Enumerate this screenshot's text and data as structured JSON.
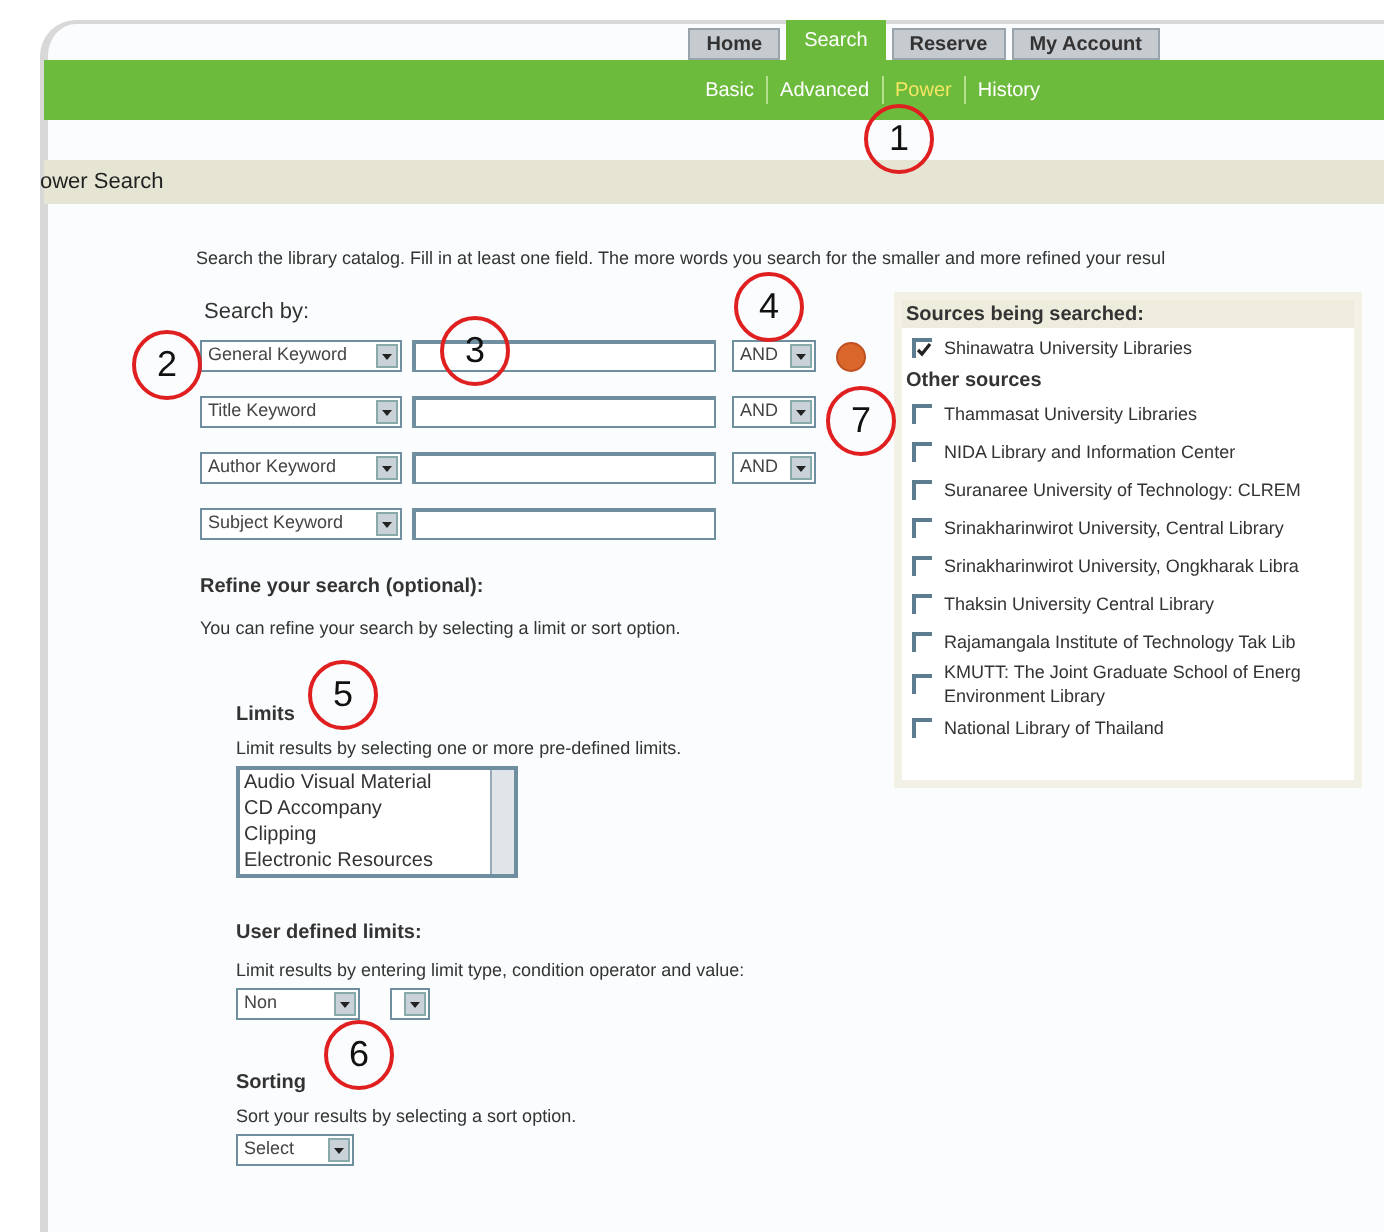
{
  "tabs": [
    {
      "label": "Home",
      "selected": false
    },
    {
      "label": "Search",
      "selected": true
    },
    {
      "label": "Reserve",
      "selected": false
    },
    {
      "label": "My Account",
      "selected": false
    }
  ],
  "subnav": [
    {
      "label": "Basic",
      "selected": false
    },
    {
      "label": "Advanced",
      "selected": false
    },
    {
      "label": "Power",
      "selected": true
    },
    {
      "label": "History",
      "selected": false
    }
  ],
  "page_title": "ower Search",
  "intro": "Search the library catalog. Fill in at least one field. The more words you search for the smaller and more refined your resul",
  "search_by": {
    "label": "Search by:",
    "rows": [
      {
        "field": "General Keyword",
        "operator": "AND",
        "go_button": true
      },
      {
        "field": "Title Keyword",
        "operator": "AND",
        "go_button": false
      },
      {
        "field": "Author Keyword",
        "operator": "AND",
        "go_button": false
      },
      {
        "field": "Subject Keyword",
        "go_button": false
      }
    ]
  },
  "refine": {
    "heading": "Refine your search (optional):",
    "text": "You can refine your search by selecting a limit or sort option."
  },
  "limits": {
    "heading": "Limits",
    "text": "Limit results by selecting one or more pre-defined limits.",
    "options": [
      "Audio Visual Material",
      "CD Accompany",
      "Clipping",
      "Electronic Resources"
    ]
  },
  "user_limits": {
    "heading": "User defined limits:",
    "text": "Limit results by entering limit type, condition operator and value:",
    "type_select": "Non"
  },
  "sorting": {
    "heading": "Sorting",
    "text": "Sort your results by selecting a sort option.",
    "select": "Select"
  },
  "sources": {
    "heading": "Sources being searched:",
    "selected": [
      {
        "label": "Shinawatra University Libraries",
        "checked": true
      }
    ],
    "other_heading": "Other sources",
    "other": [
      {
        "label": "Thammasat University Libraries",
        "checked": false
      },
      {
        "label": "NIDA Library and Information Center",
        "checked": false
      },
      {
        "label": "Suranaree University of Technology: CLREM",
        "checked": false
      },
      {
        "label": "Srinakharinwirot University, Central Library",
        "checked": false
      },
      {
        "label": "Srinakharinwirot University, Ongkharak Libra",
        "checked": false
      },
      {
        "label": "Thaksin University Central Library",
        "checked": false
      },
      {
        "label": "Rajamangala Institute of Technology Tak Lib",
        "checked": false
      },
      {
        "label": "KMUTT: The Joint Graduate School of Energ Environment Library",
        "checked": false
      },
      {
        "label": "National Library of Thailand",
        "checked": false
      }
    ]
  },
  "callouts": [
    "1",
    "2",
    "3",
    "4",
    "5",
    "6",
    "7"
  ]
}
